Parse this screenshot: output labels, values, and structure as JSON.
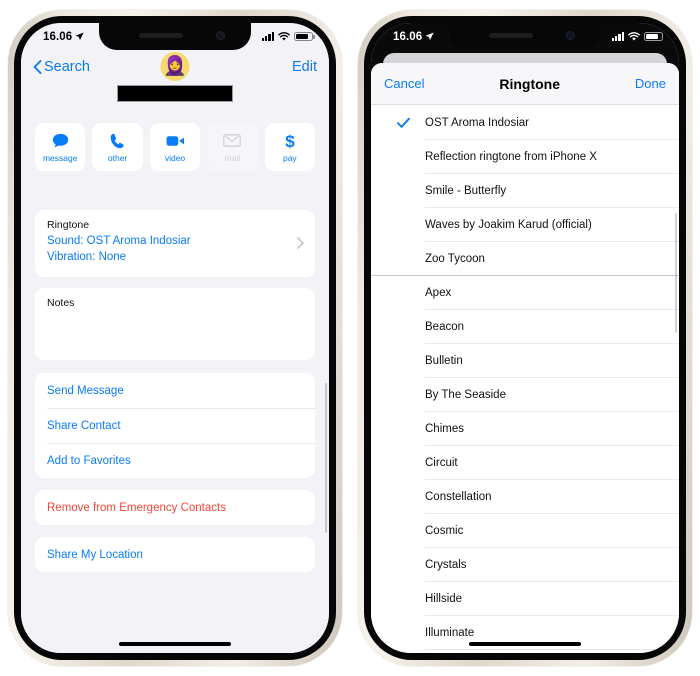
{
  "left_phone": {
    "status_bar": {
      "time": "16.06",
      "location_icon": "location-arrow-icon",
      "cellular_icon": "cellular-bars-icon",
      "wifi_icon": "wifi-icon",
      "battery_icon": "battery-icon"
    },
    "nav": {
      "back_label": "Search",
      "back_icon": "chevron-left-icon",
      "edit_label": "Edit"
    },
    "avatar": {
      "emoji": "🧕",
      "name": "contact-avatar"
    },
    "contact_name_redacted": "",
    "actions": [
      {
        "label": "message",
        "icon": "message-bubble-icon",
        "disabled": false
      },
      {
        "label": "other",
        "icon": "phone-handset-icon",
        "disabled": false
      },
      {
        "label": "video",
        "icon": "video-camera-icon",
        "disabled": false
      },
      {
        "label": "mail",
        "icon": "envelope-icon",
        "disabled": true
      },
      {
        "label": "pay",
        "icon": "dollar-sign-icon",
        "disabled": false
      }
    ],
    "ringtone_card": {
      "title": "Ringtone",
      "sound_line": "Sound: OST Aroma Indosiar",
      "vibration_line": "Vibration: None",
      "chevron_icon": "chevron-right-icon"
    },
    "notes_card": {
      "title": "Notes",
      "value": ""
    },
    "links": [
      {
        "label": "Send Message",
        "style": "link"
      },
      {
        "label": "Share Contact",
        "style": "link"
      },
      {
        "label": "Add to Favorites",
        "style": "link"
      }
    ],
    "emergency": {
      "label": "Remove from Emergency Contacts",
      "style": "danger"
    },
    "location": {
      "label": "Share My Location",
      "style": "link"
    }
  },
  "right_phone": {
    "status_bar": {
      "time": "16.06",
      "location_icon": "location-arrow-icon",
      "cellular_icon": "cellular-bars-icon",
      "wifi_icon": "wifi-icon",
      "battery_icon": "battery-icon"
    },
    "sheet": {
      "cancel_label": "Cancel",
      "title": "Ringtone",
      "done_label": "Done"
    },
    "ringtones": [
      {
        "label": "OST Aroma Indosiar",
        "selected": true,
        "section_end": false
      },
      {
        "label": "Reflection ringtone from iPhone X",
        "selected": false,
        "section_end": false
      },
      {
        "label": "Smile - Butterfly",
        "selected": false,
        "section_end": false
      },
      {
        "label": "Waves by Joakim Karud (official)",
        "selected": false,
        "section_end": false
      },
      {
        "label": "Zoo Tycoon",
        "selected": false,
        "section_end": true
      },
      {
        "label": "Apex",
        "selected": false,
        "section_end": false
      },
      {
        "label": "Beacon",
        "selected": false,
        "section_end": false
      },
      {
        "label": "Bulletin",
        "selected": false,
        "section_end": false
      },
      {
        "label": "By The Seaside",
        "selected": false,
        "section_end": false
      },
      {
        "label": "Chimes",
        "selected": false,
        "section_end": false
      },
      {
        "label": "Circuit",
        "selected": false,
        "section_end": false
      },
      {
        "label": "Constellation",
        "selected": false,
        "section_end": false
      },
      {
        "label": "Cosmic",
        "selected": false,
        "section_end": false
      },
      {
        "label": "Crystals",
        "selected": false,
        "section_end": false
      },
      {
        "label": "Hillside",
        "selected": false,
        "section_end": false
      },
      {
        "label": "Illuminate",
        "selected": false,
        "section_end": false
      }
    ],
    "check_icon": "checkmark-icon"
  },
  "colors": {
    "ios_blue": "#0a7bf7",
    "ios_red": "#f0453a",
    "screen_bg": "#f2f2f7",
    "card_bg": "#ffffff"
  }
}
